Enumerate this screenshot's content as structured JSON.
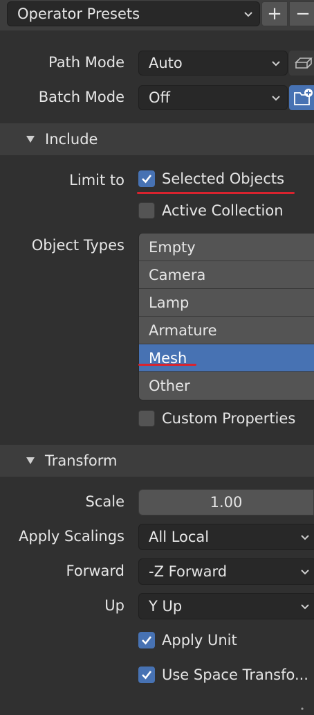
{
  "presets": {
    "label": "Operator Presets",
    "add_label": "+",
    "remove_label": "−"
  },
  "path_mode": {
    "label": "Path Mode",
    "value": "Auto"
  },
  "batch_mode": {
    "label": "Batch Mode",
    "value": "Off"
  },
  "include": {
    "title": "Include",
    "limit_to_label": "Limit to",
    "selected_objects": {
      "label": "Selected Objects",
      "checked": true
    },
    "active_collection": {
      "label": "Active Collection",
      "checked": false
    },
    "object_types_label": "Object Types",
    "object_types": [
      {
        "label": "Empty",
        "selected": false
      },
      {
        "label": "Camera",
        "selected": false
      },
      {
        "label": "Lamp",
        "selected": false
      },
      {
        "label": "Armature",
        "selected": false
      },
      {
        "label": "Mesh",
        "selected": true
      },
      {
        "label": "Other",
        "selected": false
      }
    ],
    "custom_properties": {
      "label": "Custom Properties",
      "checked": false
    }
  },
  "transform": {
    "title": "Transform",
    "scale": {
      "label": "Scale",
      "value": "1.00"
    },
    "apply_scalings": {
      "label": "Apply Scalings",
      "value": "All Local"
    },
    "forward": {
      "label": "Forward",
      "value": "-Z Forward"
    },
    "up": {
      "label": "Up",
      "value": "Y Up"
    },
    "apply_unit": {
      "label": "Apply Unit",
      "checked": true
    },
    "use_space_transform": {
      "label": "Use Space Transfo...",
      "checked": true
    }
  },
  "colors": {
    "accent": "#4772b3",
    "highlight_underline": "#d9232e",
    "panel": "#303030",
    "header": "#3d3d3d"
  }
}
